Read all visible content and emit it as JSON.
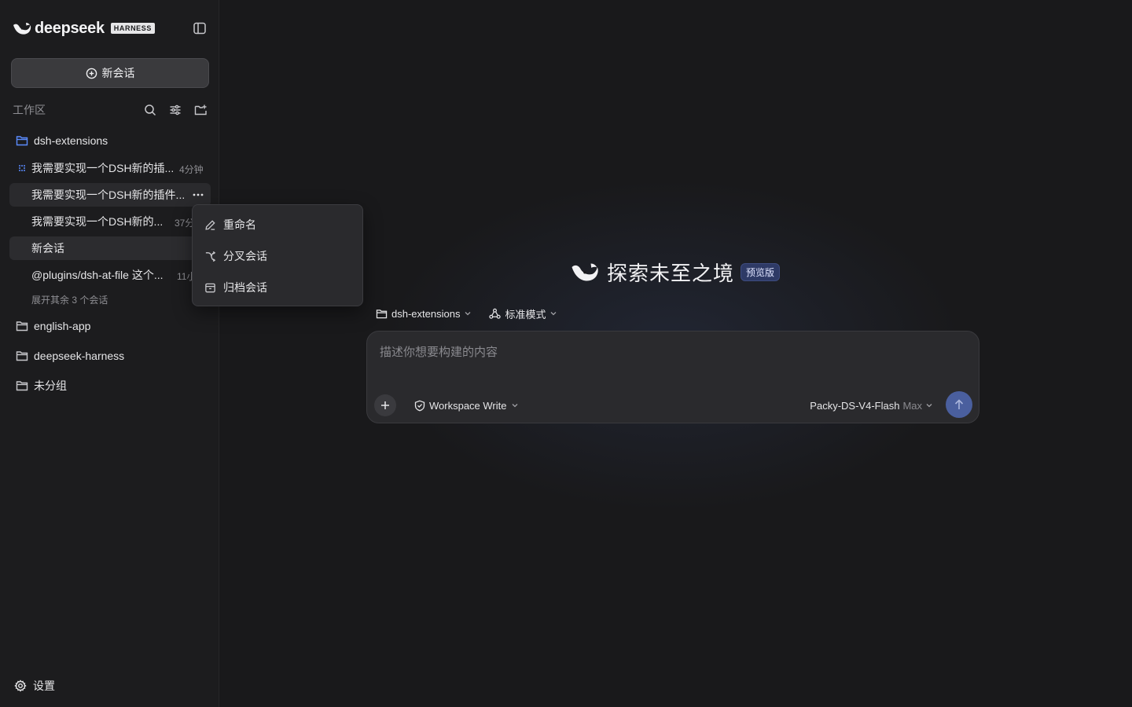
{
  "brand": {
    "name": "deepseek",
    "badge": "HARNESS"
  },
  "sidebar": {
    "new_chat_label": "新会话",
    "workspace_label": "工作区",
    "folders": [
      {
        "name": "dsh-extensions",
        "conversations": [
          {
            "title": "我需要实现一个DSH新的插...",
            "time": "4分钟"
          },
          {
            "title": "我需要实现一个DSH新的插件..."
          },
          {
            "title": "我需要实现一个DSH新的...",
            "time": "37分"
          },
          {
            "title": "新会话"
          },
          {
            "title": "@plugins/dsh-at-file 这个...",
            "time": "11小"
          }
        ],
        "expand_label": "展开其余 3 个会话"
      },
      {
        "name": "english-app"
      },
      {
        "name": "deepseek-harness"
      },
      {
        "name": "未分组"
      }
    ],
    "settings_label": "设置"
  },
  "context_menu": {
    "items": [
      {
        "label": "重命名",
        "icon": "pencil-icon"
      },
      {
        "label": "分叉会话",
        "icon": "branch-icon"
      },
      {
        "label": "归档会话",
        "icon": "archive-icon"
      }
    ]
  },
  "main": {
    "hero_title": "探索未至之境",
    "hero_badge": "预览版",
    "project_selector": "dsh-extensions",
    "mode_selector": "标准模式",
    "composer": {
      "placeholder": "描述你想要构建的内容",
      "value": "",
      "permission": "Workspace Write",
      "model": "Packy-DS-V4-Flash",
      "model_tier": "Max"
    }
  },
  "colors": {
    "background": "#19191b",
    "sidebar": "#1c1c1e",
    "accent": "#4a5f9e",
    "folder_active": "#5b8cff"
  }
}
